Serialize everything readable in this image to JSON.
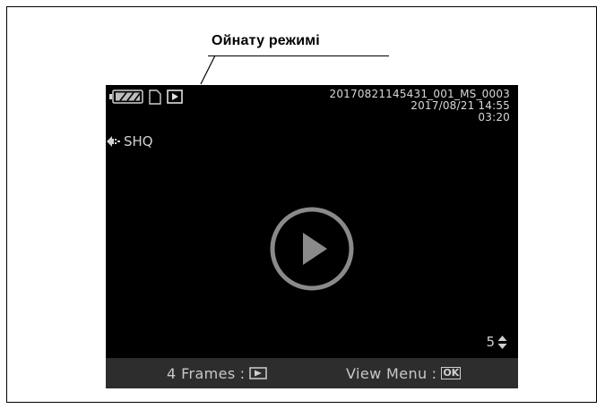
{
  "callout": {
    "label": "Ойнату режимі"
  },
  "status": {
    "battery_icon": "battery-icon",
    "card_icon": "memory-card-icon",
    "mode_icon": "playback-mode-icon"
  },
  "info": {
    "filename": "20170821145431_001_MS_0003",
    "datetime": "2017/08/21 14:55",
    "duration": "03:20"
  },
  "quality": {
    "icon": "quality-arrow-icon",
    "label": "SHQ"
  },
  "counter": {
    "value": "5",
    "icon": "up-down-icon"
  },
  "bottom_bar": {
    "frames_label": "4 Frames",
    "frames_separator": ":",
    "frames_key_icon": "play-key-icon",
    "menu_label": "View Menu",
    "menu_separator": ":",
    "menu_key": "OK"
  },
  "colors": {
    "screen_background": "#000000",
    "bottom_bar_background": "#2d2d2d",
    "text": "#d8d8d8"
  }
}
